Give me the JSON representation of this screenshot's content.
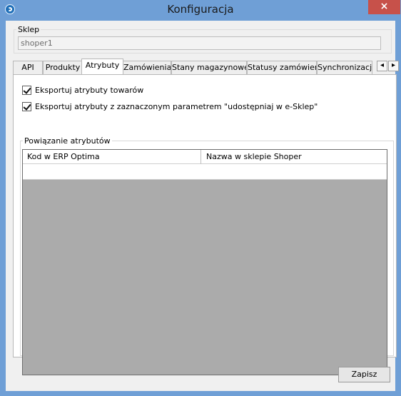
{
  "window": {
    "title": "Konfiguracja",
    "close_label": "×",
    "icon": "refresh-app-icon"
  },
  "sklep": {
    "label": "Sklep",
    "value": "shoper1"
  },
  "tabs": [
    {
      "label": "API"
    },
    {
      "label": "Produkty"
    },
    {
      "label": "Atrybuty",
      "active": true
    },
    {
      "label": "Zamówienia"
    },
    {
      "label": "Stany magazynowe"
    },
    {
      "label": "Statusy zamówień"
    },
    {
      "label": "Synchronizacja a"
    }
  ],
  "tab_scroll": {
    "left": "◂",
    "right": "▸"
  },
  "atrybuty": {
    "checkbox_export_label": "Eksportuj atrybuty towarów",
    "checkbox_share_label": "Eksportuj atrybuty z zaznaczonym parametrem \"udostępniaj w e-Sklep\"",
    "group_label": "Powiązanie atrybutów",
    "table_headers": [
      "Kod w ERP Optima",
      "Nazwa w sklepie Shoper"
    ],
    "rows": [
      [
        "",
        ""
      ]
    ]
  },
  "buttons": {
    "save": "Zapisz"
  },
  "colors": {
    "title_bar": "#6f9fd6",
    "close_button": "#c7514a",
    "grid_empty": "#ababab"
  }
}
